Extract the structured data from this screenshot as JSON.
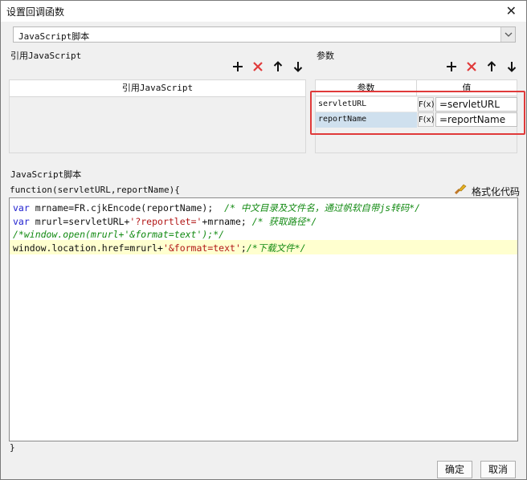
{
  "window": {
    "title": "设置回调函数",
    "close_glyph": "✕"
  },
  "type_select": {
    "value": "JavaScript脚本",
    "arrow": "⌄"
  },
  "ref_section": {
    "label": "引用JavaScript",
    "column_header": "引用JavaScript"
  },
  "param_section": {
    "label": "参数",
    "col_param": "参数",
    "col_value": "值",
    "rows": [
      {
        "name": "servletURL",
        "fx": "F(x)",
        "value": "=servletURL"
      },
      {
        "name": "reportName",
        "fx": "F(x)",
        "value": "=reportName"
      }
    ]
  },
  "toolbar": {
    "add": "+",
    "delete": "✕",
    "up": "↑",
    "down": "↓"
  },
  "script_section": {
    "label": "JavaScript脚本",
    "signature": "function(servletURL,reportName){",
    "format_label": "格式化代码",
    "closing": "}"
  },
  "code": {
    "l1_kw": "var",
    "l1_a": " mrname=FR.cjkEncode(reportName);  ",
    "l1_c": "/* 中文目录及文件名，通过帆软自带js转码*/",
    "l2_kw": "var",
    "l2_a": " mrurl=servletURL+",
    "l2_s": "'?reportlet='",
    "l2_b": "+mrname; ",
    "l2_c": "/* 获取路径*/",
    "l3_c": "/*window.open(mrurl+'&format=text');*/",
    "l4_a": "window.location.href=mrurl+",
    "l4_s": "'&format=text'",
    "l4_b": ";",
    "l4_c": "/*下载文件*/"
  },
  "footer": {
    "ok": "确定",
    "cancel": "取消"
  },
  "colors": {
    "red": "#e03a3a",
    "keyword": "#1f1fcf",
    "string": "#b21717",
    "comment": "#128a12",
    "highlight": "#ffffcf"
  }
}
